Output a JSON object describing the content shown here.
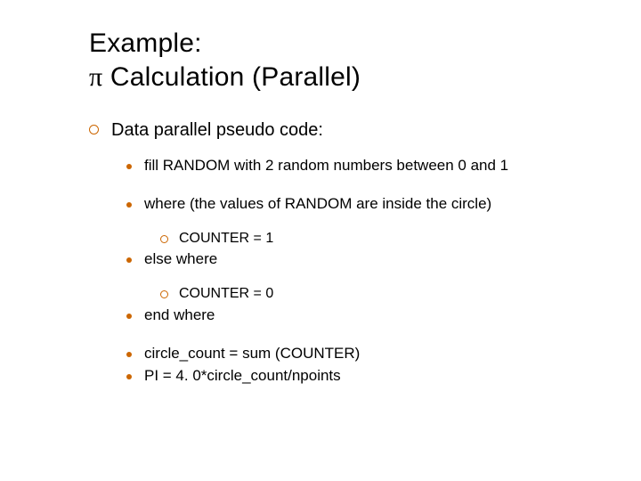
{
  "title_line1": "Example:",
  "title_pi": "π",
  "title_rest": " Calculation (Parallel)",
  "lvl1": "Data parallel pseudo code:",
  "items": {
    "fill": "fill RANDOM with 2 random numbers between 0 and 1",
    "where": "where (the values of RANDOM are inside the circle)",
    "counter1": "COUNTER = 1",
    "elsewhere": "else where",
    "counter0": "COUNTER = 0",
    "endwhere": "end where",
    "circlecount": "circle_count = sum (COUNTER)",
    "pi": "PI = 4. 0*circle_count/npoints"
  }
}
